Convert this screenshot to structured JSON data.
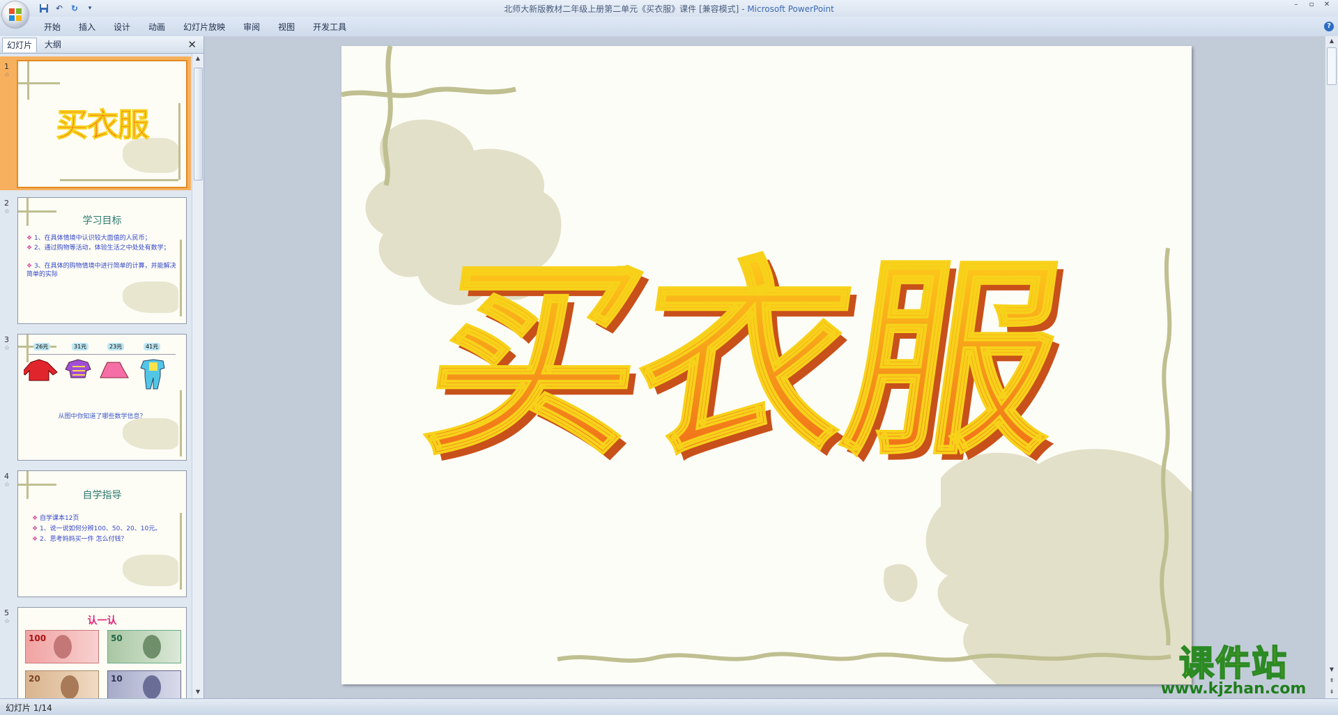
{
  "window": {
    "title": "北师大新版教材二年级上册第二单元《买衣服》课件 [兼容模式] - ",
    "app_name": "Microsoft PowerPoint"
  },
  "ribbon": {
    "tabs": [
      "开始",
      "插入",
      "设计",
      "动画",
      "幻灯片放映",
      "审阅",
      "视图",
      "开发工具"
    ],
    "help": "?"
  },
  "left_pane": {
    "tab_slides": "幻灯片",
    "tab_outline": "大纲",
    "close": "✕",
    "slides": [
      {
        "number": "1",
        "title": "买衣服"
      },
      {
        "number": "2",
        "title": "学习目标",
        "lines": [
          "1、在具体情境中认识较大面值的人民币；",
          "2、通过购物等活动，体验生活之中处处有数学；",
          "3、在具体的购物情境中进行简单的计算，并能解决简单的实际"
        ]
      },
      {
        "number": "3",
        "prices": [
          "26元",
          "31元",
          "23元",
          "41元"
        ],
        "caption": "从图中你知道了哪些数学信息？"
      },
      {
        "number": "4",
        "title": "自学指导",
        "lines": [
          "自学课本12页",
          "1、说一说如何分辨100、50、20、10元。",
          "2、思考妈妈买一件 怎么付钱？"
        ]
      },
      {
        "number": "5",
        "title": "认一认",
        "notes": [
          "100",
          "50",
          "20",
          "10"
        ]
      }
    ]
  },
  "slide": {
    "title": "买衣服"
  },
  "status": {
    "text": "幻灯片 1/14"
  },
  "watermark": {
    "cn": "课件站",
    "url": "www.kjzhan.com"
  },
  "colors": {
    "title_orange": "#f0721c",
    "title_yellow": "#f7d21a",
    "deco_green": "#bfbf91",
    "selection": "#f7b05d"
  }
}
